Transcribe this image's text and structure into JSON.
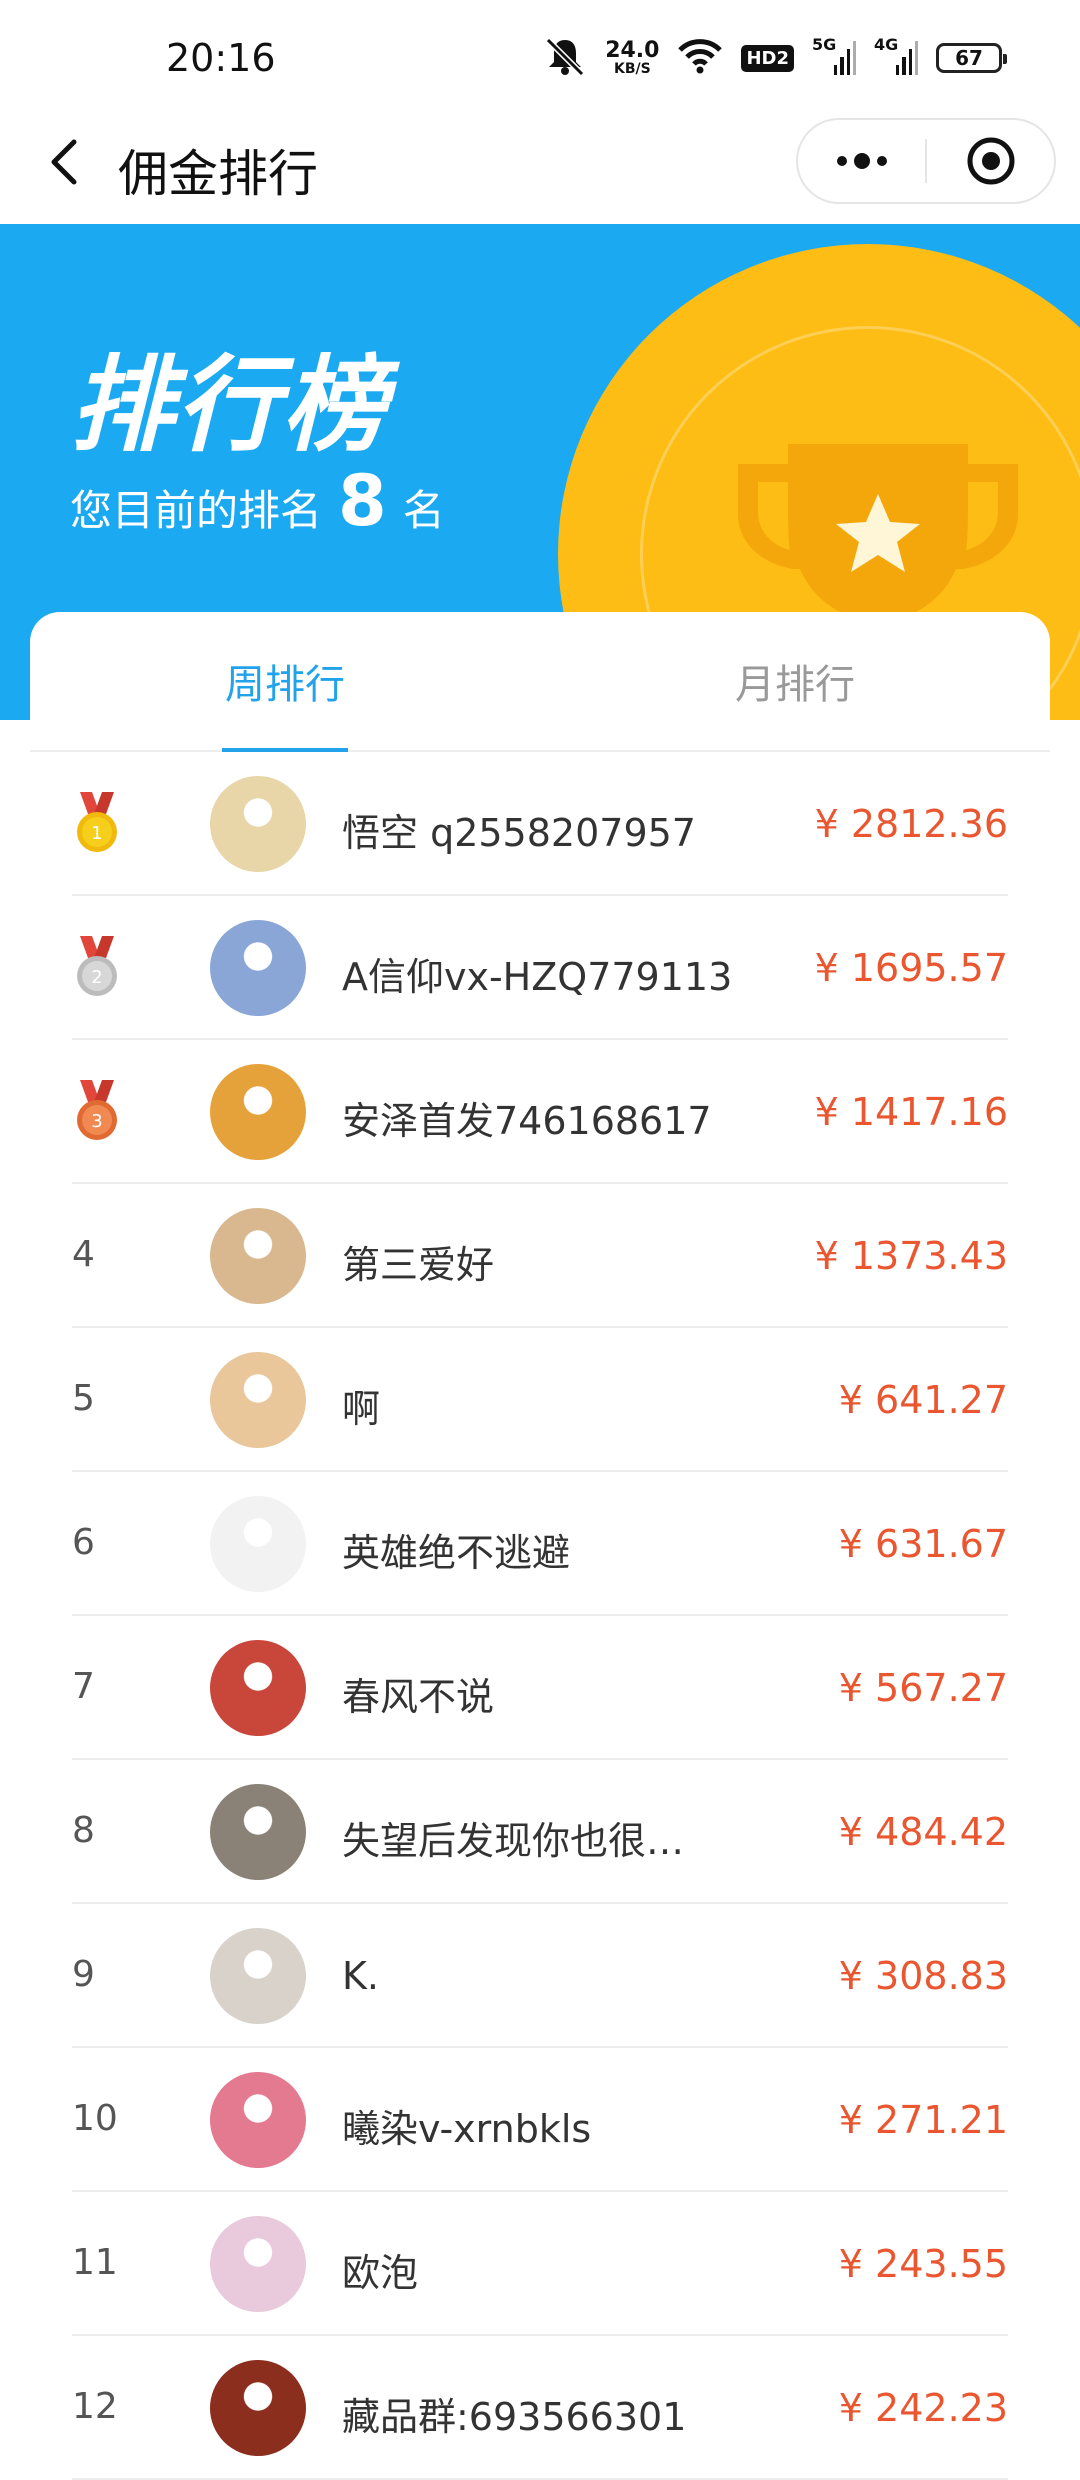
{
  "status": {
    "time": "20:16",
    "net_speed": "24.0",
    "net_unit": "KB/S",
    "hd_badge": "HD2",
    "signal1_label": "5G",
    "signal2_label": "4G",
    "battery": "67"
  },
  "nav": {
    "title": "佣金排行"
  },
  "banner": {
    "title": "排行榜",
    "rank_prefix": "您目前的排名",
    "rank_value": "8",
    "rank_suffix": "名"
  },
  "tabs": [
    {
      "label": "周排行",
      "active": true
    },
    {
      "label": "月排行",
      "active": false
    }
  ],
  "colors": {
    "banner_blue": "#1ba9f2",
    "coin_yellow": "#fdbd14",
    "tab_active": "#22a2ea",
    "amount_red": "#e9562f"
  },
  "rankings": [
    {
      "rank": "1",
      "medal": "gold",
      "name": "悟空 q2558207957",
      "amount": "¥ 2812.36",
      "avatar_color": "#e8d6a8"
    },
    {
      "rank": "2",
      "medal": "silver",
      "name": "A信仰vx-HZQ779113",
      "amount": "¥ 1695.57",
      "avatar_color": "#8aa6d6"
    },
    {
      "rank": "3",
      "medal": "bronze",
      "name": "安泽首发746168617",
      "amount": "¥ 1417.16",
      "avatar_color": "#e6a23a"
    },
    {
      "rank": "4",
      "medal": "",
      "name": "第三爱好",
      "amount": "¥ 1373.43",
      "avatar_color": "#d9b88f"
    },
    {
      "rank": "5",
      "medal": "",
      "name": "啊",
      "amount": "¥ 641.27",
      "avatar_color": "#e9c79a"
    },
    {
      "rank": "6",
      "medal": "",
      "name": "英雄绝不逃避",
      "amount": "¥ 631.67",
      "avatar_color": "#f2f2f2"
    },
    {
      "rank": "7",
      "medal": "",
      "name": "春风不说",
      "amount": "¥ 567.27",
      "avatar_color": "#c9463a"
    },
    {
      "rank": "8",
      "medal": "",
      "name": "失望后发现你也很…",
      "amount": "¥ 484.42",
      "avatar_color": "#8a8276"
    },
    {
      "rank": "9",
      "medal": "",
      "name": "K.",
      "amount": "¥ 308.83",
      "avatar_color": "#d8d2cb"
    },
    {
      "rank": "10",
      "medal": "",
      "name": "曦染v-xrnbkls",
      "amount": "¥ 271.21",
      "avatar_color": "#e37a8f"
    },
    {
      "rank": "11",
      "medal": "",
      "name": "欧泡",
      "amount": "¥ 243.55",
      "avatar_color": "#e9c9dc"
    },
    {
      "rank": "12",
      "medal": "",
      "name": "藏品群:693566301",
      "amount": "¥ 242.23",
      "avatar_color": "#8b2e1e"
    }
  ]
}
